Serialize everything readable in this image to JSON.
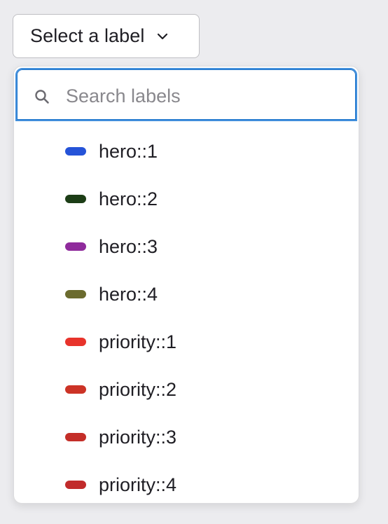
{
  "dropdown": {
    "toggle_label": "Select a label",
    "toggle_icon": "chevron-down-icon",
    "search": {
      "placeholder": "Search labels",
      "value": "",
      "icon": "search-icon"
    },
    "items": [
      {
        "label": "hero::1",
        "color": "#2553d8"
      },
      {
        "label": "hero::2",
        "color": "#1c3d16"
      },
      {
        "label": "hero::3",
        "color": "#8f2b9c"
      },
      {
        "label": "hero::4",
        "color": "#6b6b2e"
      },
      {
        "label": "priority::1",
        "color": "#e8332b"
      },
      {
        "label": "priority::2",
        "color": "#cc3326"
      },
      {
        "label": "priority::3",
        "color": "#c42e28"
      },
      {
        "label": "priority::4",
        "color": "#c12b2b"
      }
    ]
  }
}
